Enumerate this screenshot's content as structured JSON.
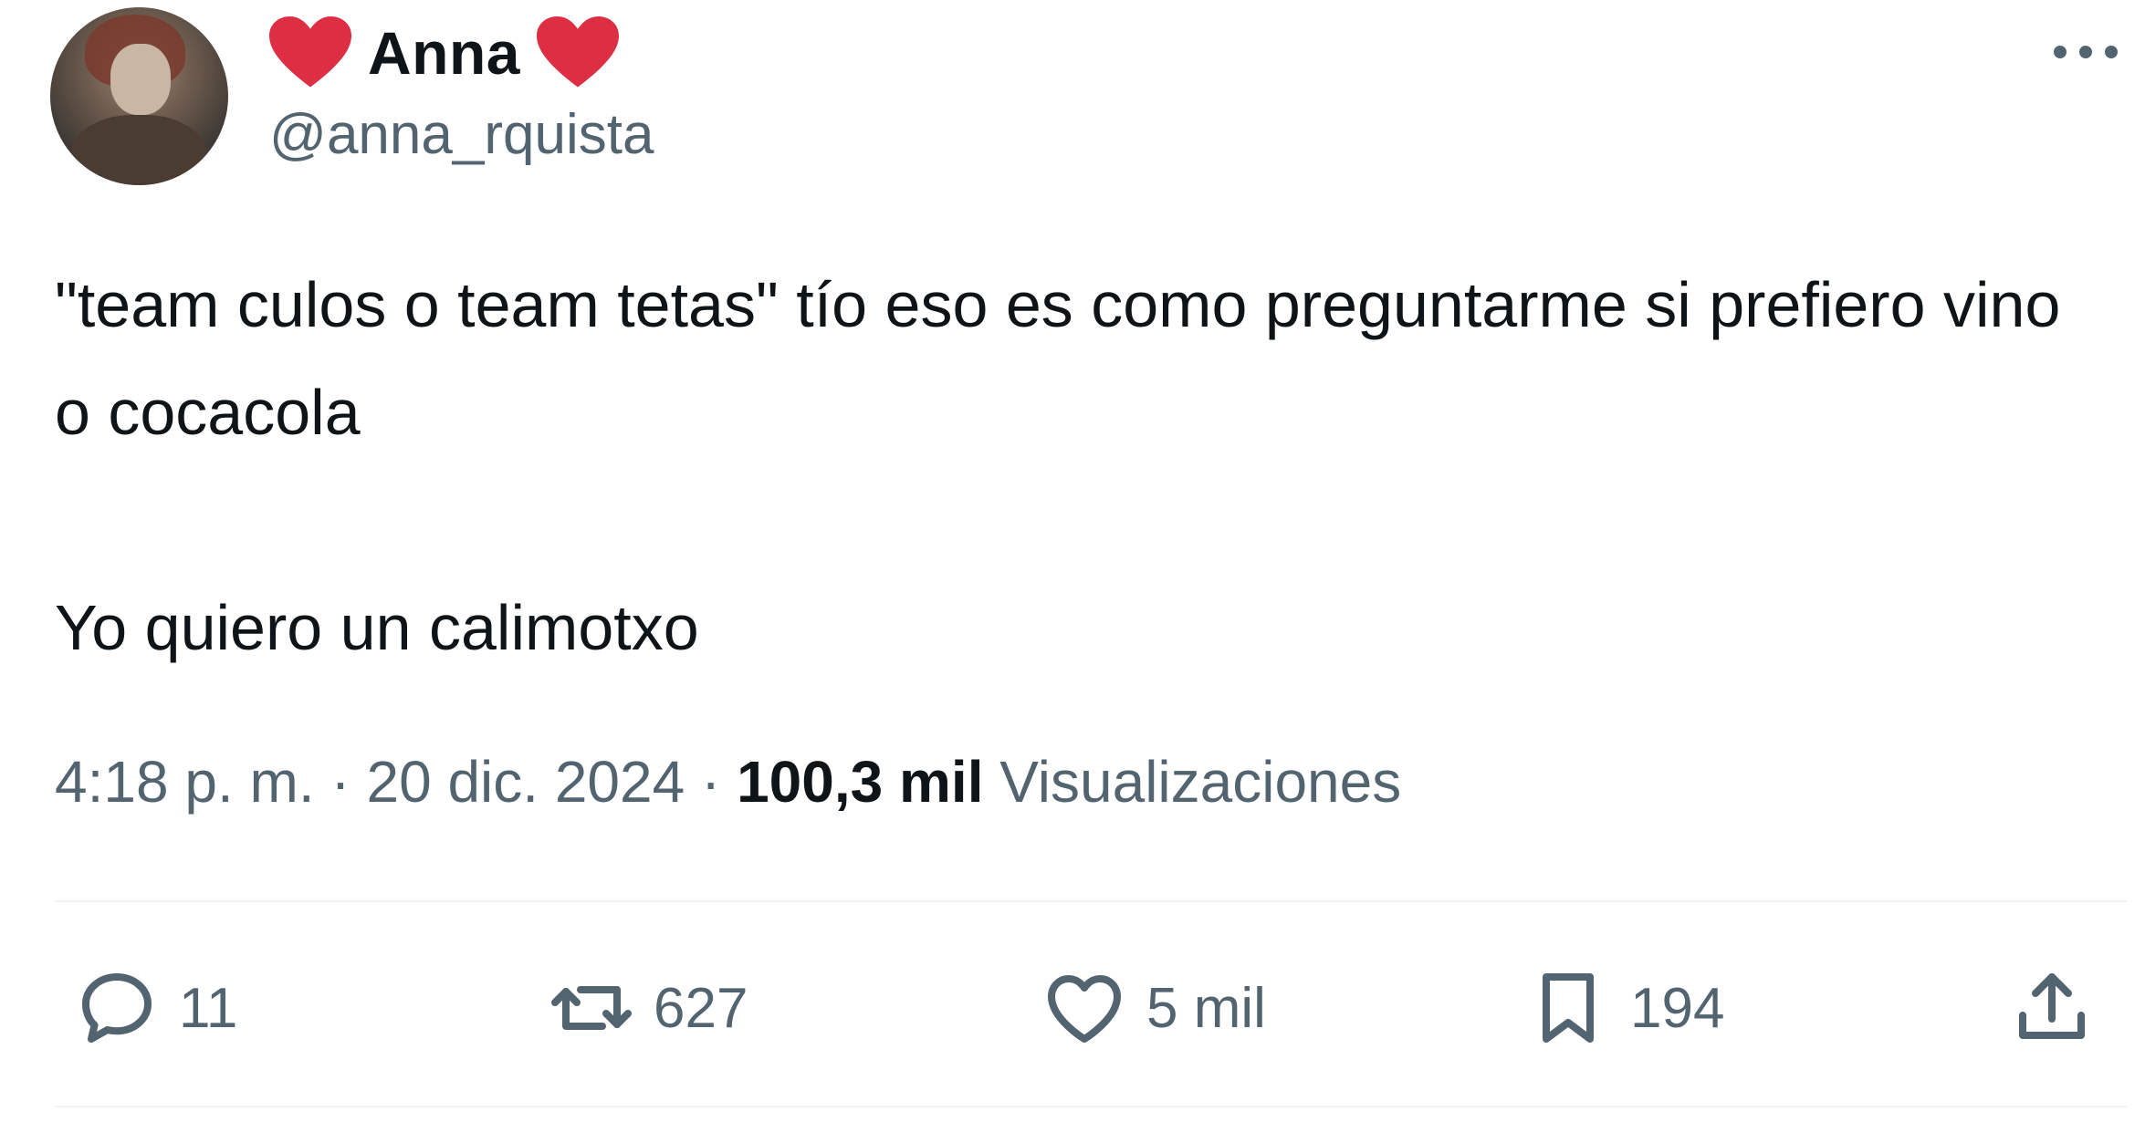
{
  "author": {
    "display_name": "Anna",
    "handle": "@anna_rquista",
    "heart_color": "#dd2e44"
  },
  "tweet": {
    "paragraphs": [
      "\"team culos o team tetas\" tío eso es como preguntarme si prefiero vino o cocacola",
      "Yo quiero un calimotxo"
    ]
  },
  "meta": {
    "time": "4:18 p. m.",
    "separator": "·",
    "date": "20 dic. 2024",
    "views_count": "100,3 mil",
    "views_label": "Visualizaciones"
  },
  "actions": {
    "reply_count": "11",
    "repost_count": "627",
    "like_count": "5 mil",
    "bookmark_count": "194"
  },
  "icons": [
    "heart-icon",
    "more-icon",
    "reply-icon",
    "repost-icon",
    "like-icon",
    "bookmark-icon",
    "share-icon"
  ],
  "colors": {
    "text": "#0f1419",
    "secondary": "#536471",
    "divider": "#eff3f4"
  }
}
